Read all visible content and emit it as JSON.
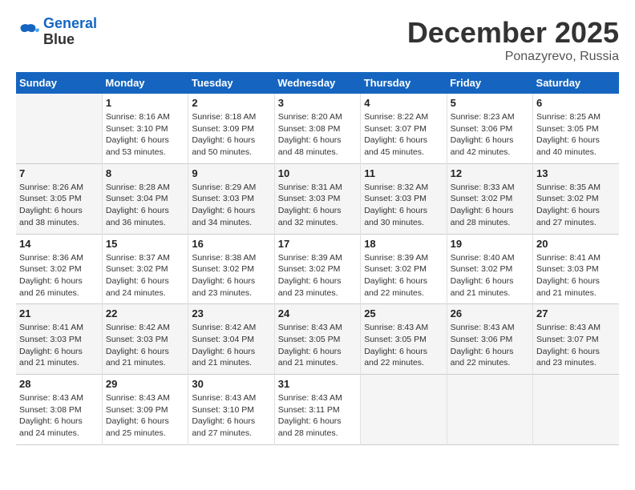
{
  "logo": {
    "line1": "General",
    "line2": "Blue"
  },
  "title": "December 2025",
  "location": "Ponazyrevo, Russia",
  "days_header": [
    "Sunday",
    "Monday",
    "Tuesday",
    "Wednesday",
    "Thursday",
    "Friday",
    "Saturday"
  ],
  "weeks": [
    [
      {
        "day": "",
        "info": ""
      },
      {
        "day": "1",
        "info": "Sunrise: 8:16 AM\nSunset: 3:10 PM\nDaylight: 6 hours\nand 53 minutes."
      },
      {
        "day": "2",
        "info": "Sunrise: 8:18 AM\nSunset: 3:09 PM\nDaylight: 6 hours\nand 50 minutes."
      },
      {
        "day": "3",
        "info": "Sunrise: 8:20 AM\nSunset: 3:08 PM\nDaylight: 6 hours\nand 48 minutes."
      },
      {
        "day": "4",
        "info": "Sunrise: 8:22 AM\nSunset: 3:07 PM\nDaylight: 6 hours\nand 45 minutes."
      },
      {
        "day": "5",
        "info": "Sunrise: 8:23 AM\nSunset: 3:06 PM\nDaylight: 6 hours\nand 42 minutes."
      },
      {
        "day": "6",
        "info": "Sunrise: 8:25 AM\nSunset: 3:05 PM\nDaylight: 6 hours\nand 40 minutes."
      }
    ],
    [
      {
        "day": "7",
        "info": "Sunrise: 8:26 AM\nSunset: 3:05 PM\nDaylight: 6 hours\nand 38 minutes."
      },
      {
        "day": "8",
        "info": "Sunrise: 8:28 AM\nSunset: 3:04 PM\nDaylight: 6 hours\nand 36 minutes."
      },
      {
        "day": "9",
        "info": "Sunrise: 8:29 AM\nSunset: 3:03 PM\nDaylight: 6 hours\nand 34 minutes."
      },
      {
        "day": "10",
        "info": "Sunrise: 8:31 AM\nSunset: 3:03 PM\nDaylight: 6 hours\nand 32 minutes."
      },
      {
        "day": "11",
        "info": "Sunrise: 8:32 AM\nSunset: 3:03 PM\nDaylight: 6 hours\nand 30 minutes."
      },
      {
        "day": "12",
        "info": "Sunrise: 8:33 AM\nSunset: 3:02 PM\nDaylight: 6 hours\nand 28 minutes."
      },
      {
        "day": "13",
        "info": "Sunrise: 8:35 AM\nSunset: 3:02 PM\nDaylight: 6 hours\nand 27 minutes."
      }
    ],
    [
      {
        "day": "14",
        "info": "Sunrise: 8:36 AM\nSunset: 3:02 PM\nDaylight: 6 hours\nand 26 minutes."
      },
      {
        "day": "15",
        "info": "Sunrise: 8:37 AM\nSunset: 3:02 PM\nDaylight: 6 hours\nand 24 minutes."
      },
      {
        "day": "16",
        "info": "Sunrise: 8:38 AM\nSunset: 3:02 PM\nDaylight: 6 hours\nand 23 minutes."
      },
      {
        "day": "17",
        "info": "Sunrise: 8:39 AM\nSunset: 3:02 PM\nDaylight: 6 hours\nand 23 minutes."
      },
      {
        "day": "18",
        "info": "Sunrise: 8:39 AM\nSunset: 3:02 PM\nDaylight: 6 hours\nand 22 minutes."
      },
      {
        "day": "19",
        "info": "Sunrise: 8:40 AM\nSunset: 3:02 PM\nDaylight: 6 hours\nand 21 minutes."
      },
      {
        "day": "20",
        "info": "Sunrise: 8:41 AM\nSunset: 3:03 PM\nDaylight: 6 hours\nand 21 minutes."
      }
    ],
    [
      {
        "day": "21",
        "info": "Sunrise: 8:41 AM\nSunset: 3:03 PM\nDaylight: 6 hours\nand 21 minutes."
      },
      {
        "day": "22",
        "info": "Sunrise: 8:42 AM\nSunset: 3:03 PM\nDaylight: 6 hours\nand 21 minutes."
      },
      {
        "day": "23",
        "info": "Sunrise: 8:42 AM\nSunset: 3:04 PM\nDaylight: 6 hours\nand 21 minutes."
      },
      {
        "day": "24",
        "info": "Sunrise: 8:43 AM\nSunset: 3:05 PM\nDaylight: 6 hours\nand 21 minutes."
      },
      {
        "day": "25",
        "info": "Sunrise: 8:43 AM\nSunset: 3:05 PM\nDaylight: 6 hours\nand 22 minutes."
      },
      {
        "day": "26",
        "info": "Sunrise: 8:43 AM\nSunset: 3:06 PM\nDaylight: 6 hours\nand 22 minutes."
      },
      {
        "day": "27",
        "info": "Sunrise: 8:43 AM\nSunset: 3:07 PM\nDaylight: 6 hours\nand 23 minutes."
      }
    ],
    [
      {
        "day": "28",
        "info": "Sunrise: 8:43 AM\nSunset: 3:08 PM\nDaylight: 6 hours\nand 24 minutes."
      },
      {
        "day": "29",
        "info": "Sunrise: 8:43 AM\nSunset: 3:09 PM\nDaylight: 6 hours\nand 25 minutes."
      },
      {
        "day": "30",
        "info": "Sunrise: 8:43 AM\nSunset: 3:10 PM\nDaylight: 6 hours\nand 27 minutes."
      },
      {
        "day": "31",
        "info": "Sunrise: 8:43 AM\nSunset: 3:11 PM\nDaylight: 6 hours\nand 28 minutes."
      },
      {
        "day": "",
        "info": ""
      },
      {
        "day": "",
        "info": ""
      },
      {
        "day": "",
        "info": ""
      }
    ]
  ]
}
